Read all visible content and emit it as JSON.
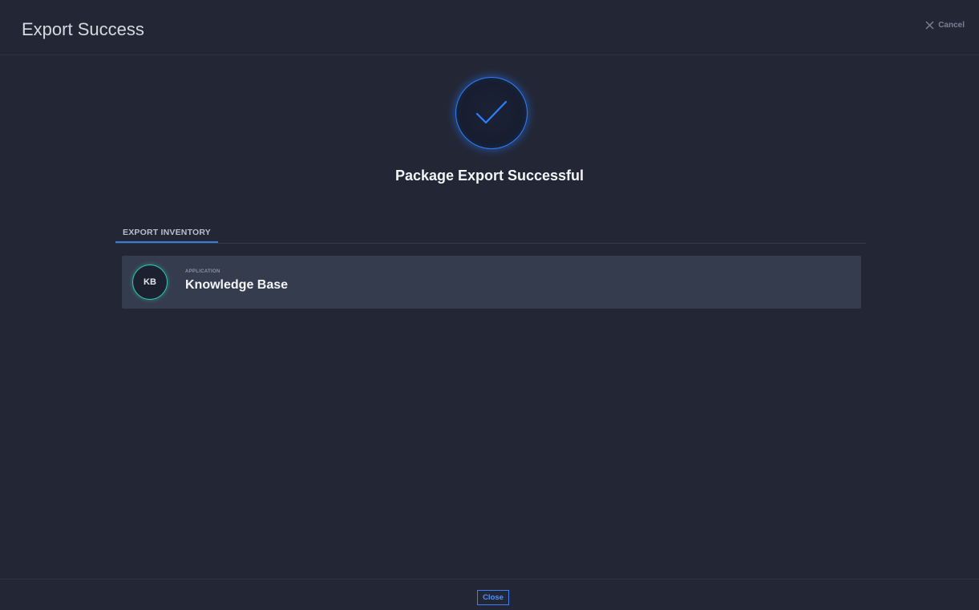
{
  "header": {
    "title": "Export Success",
    "cancel_label": "Cancel"
  },
  "status": {
    "message": "Package Export Successful",
    "accent_color": "#2d7fff"
  },
  "tabs": [
    {
      "label": "EXPORT INVENTORY",
      "active": true
    }
  ],
  "inventory": [
    {
      "initials": "KB",
      "type": "APPLICATION",
      "name": "Knowledge Base",
      "ring_color": "#2cc9b4"
    }
  ],
  "footer": {
    "close_label": "Close"
  },
  "icons": {
    "cancel": "close-icon",
    "status": "checkmark-icon"
  }
}
